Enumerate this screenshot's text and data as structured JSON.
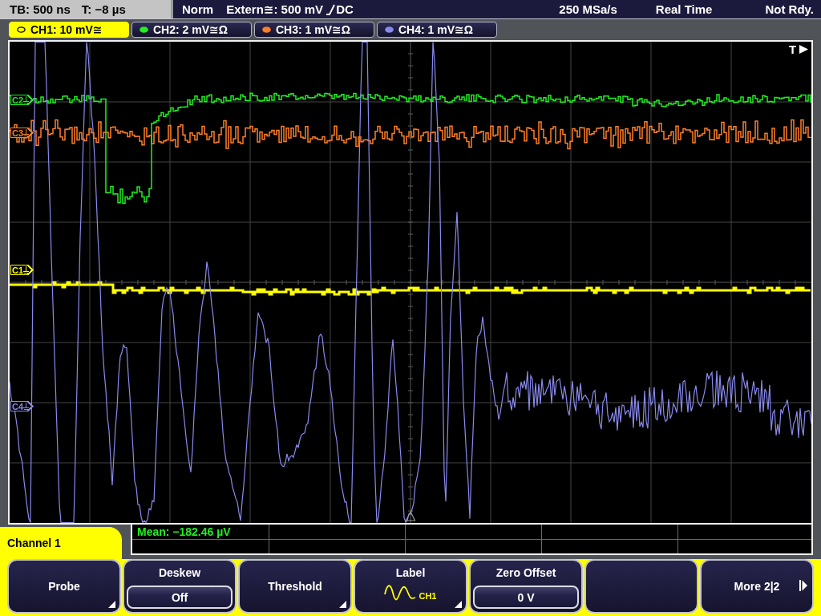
{
  "status_bar": {
    "timebase": "TB: 500 ns",
    "trigger_offset": "T: −8 µs",
    "trigger_mode": "Norm",
    "trigger_source": "Extern≅: 500 mV",
    "trigger_slope_rising": true,
    "trigger_coupling": "DC",
    "sample_rate": "250 MSa/s",
    "acquisition": "Real Time",
    "state": "Not Rdy."
  },
  "channels": [
    {
      "label": "CH1: 10 mV≅",
      "color": "#ffff00",
      "selected": true
    },
    {
      "label": "CH2: 2 mV≅Ω",
      "color": "#22ee22",
      "selected": false
    },
    {
      "label": "CH3: 1 mV≅Ω",
      "color": "#ff7f27",
      "selected": false
    },
    {
      "label": "CH4: 1 mV≅Ω",
      "color": "#8a8aee",
      "selected": false
    }
  ],
  "display": {
    "trigger_marker": "T",
    "markers": [
      {
        "label": "C2",
        "color": "#22ee22"
      },
      {
        "label": "C3",
        "color": "#ff7f27"
      },
      {
        "label": "C1",
        "color": "#ffff00"
      },
      {
        "label": "C4",
        "color": "#8a8aee"
      }
    ]
  },
  "measurement": "Mean: −182.46 µV",
  "menu": {
    "title": "Channel 1",
    "softkeys": [
      {
        "kind": "menu",
        "label": "Probe"
      },
      {
        "kind": "value",
        "label": "Deskew",
        "value": "Off"
      },
      {
        "kind": "menu",
        "label": "Threshold"
      },
      {
        "kind": "label",
        "label": "Label",
        "value": "CH1"
      },
      {
        "kind": "value",
        "label": "Zero Offset",
        "value": "0 V"
      },
      {
        "kind": "blank"
      },
      {
        "kind": "next",
        "label": "More 2|2"
      }
    ]
  }
}
